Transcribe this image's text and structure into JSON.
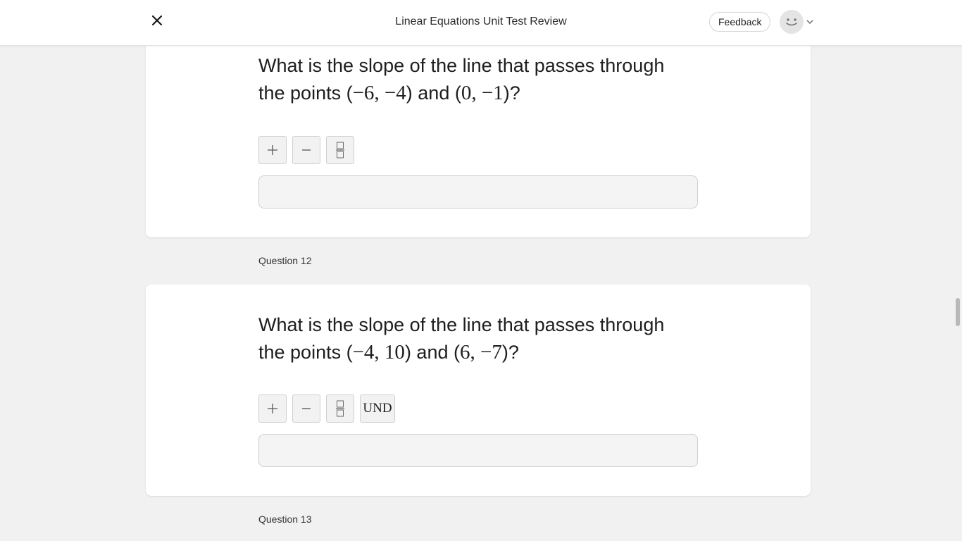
{
  "header": {
    "title": "Linear Equations Unit Test Review",
    "feedback_label": "Feedback",
    "close_icon": "close-icon",
    "avatar_icon": "smiley-avatar",
    "menu_icon": "chevron-down-icon"
  },
  "questions": [
    {
      "prompt_prefix": "What is the slope of the line that passes through the points (",
      "p1": "−6, −4",
      "mid": ") and (",
      "p2": "0, −1",
      "suffix": ")?",
      "tools": [
        "plus",
        "minus",
        "fraction"
      ],
      "answer_value": ""
    },
    {
      "label": "Question 12",
      "prompt_prefix": "What is the slope of the line that passes through the points (",
      "p1": "−4, 10",
      "mid": ") and (",
      "p2": "6, −7",
      "suffix": ")?",
      "tools": [
        "plus",
        "minus",
        "fraction",
        "UND"
      ],
      "und_label": "UND",
      "answer_value": ""
    },
    {
      "label": "Question 13"
    }
  ],
  "colors": {
    "page_background": "#f1f1f1",
    "card_background": "#ffffff",
    "tool_background": "#f2f2f2"
  }
}
